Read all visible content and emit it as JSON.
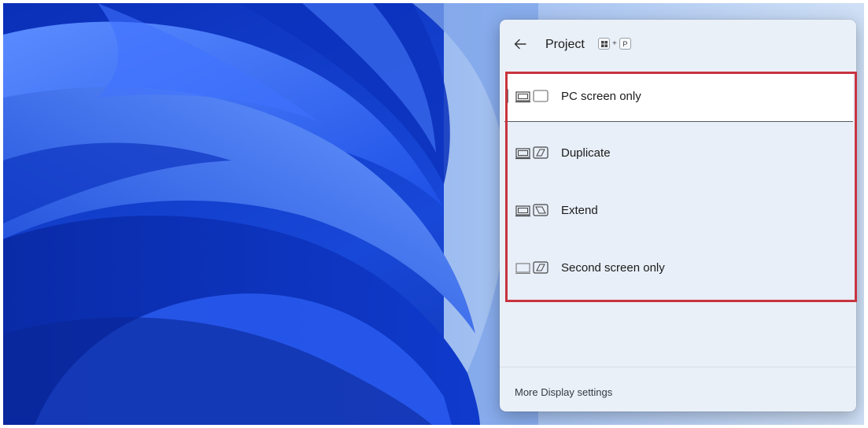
{
  "flyout": {
    "title": "Project",
    "shortcut": {
      "modifier_icon": "windows-logo-key-icon",
      "plus": "+",
      "key": "P"
    },
    "back_icon": "back-arrow-icon"
  },
  "options": [
    {
      "label": "PC screen only",
      "icon": "pc-screen-only-icon",
      "selected": true
    },
    {
      "label": "Duplicate",
      "icon": "duplicate-icon",
      "selected": false
    },
    {
      "label": "Extend",
      "icon": "extend-icon",
      "selected": false
    },
    {
      "label": "Second screen only",
      "icon": "second-screen-only-icon",
      "selected": false
    }
  ],
  "footer": {
    "link": "More Display settings"
  },
  "colors": {
    "highlight_border": "#c8343f",
    "panel_background": "#eaf0f8",
    "selected_background": "#ffffff",
    "wallpaper_accent": "#1a4fe0"
  }
}
